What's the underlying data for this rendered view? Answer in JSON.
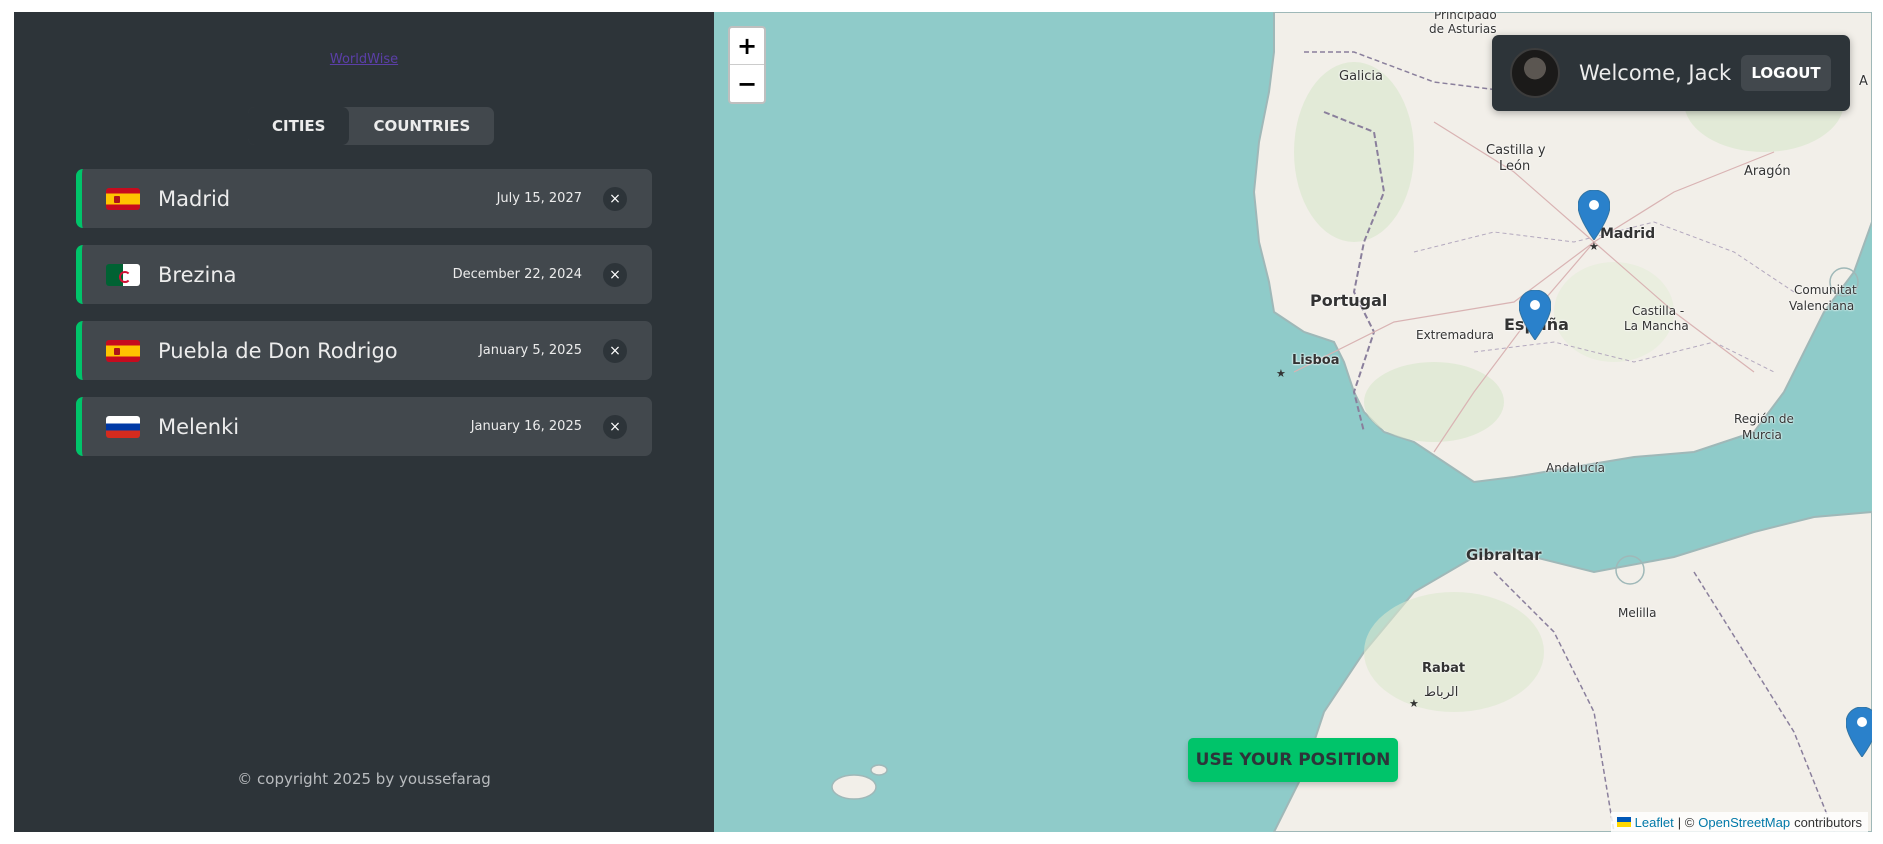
{
  "sidebar": {
    "logo_text": "WorldWise",
    "tabs": [
      {
        "label": "CITIES",
        "active": true
      },
      {
        "label": "COUNTRIES",
        "active": false
      }
    ],
    "cities": [
      {
        "name": "Madrid",
        "date": "July 15, 2027",
        "flag": "es"
      },
      {
        "name": "Brezina",
        "date": "December 22, 2024",
        "flag": "dz"
      },
      {
        "name": "Puebla de Don Rodrigo",
        "date": "January 5, 2025",
        "flag": "es"
      },
      {
        "name": "Melenki",
        "date": "January 16, 2025",
        "flag": "ru"
      }
    ],
    "delete_label": "×",
    "copyright": "© copyright 2025 by youssefarag"
  },
  "map": {
    "zoom_in": "+",
    "zoom_out": "−",
    "user": {
      "welcome": "Welcome, Jack",
      "logout": "LOGOUT"
    },
    "use_position": "USE YOUR POSITION",
    "attribution": {
      "leaflet": "Leaflet",
      "separator": "| ©",
      "osm": "OpenStreetMap",
      "suffix": "contributors"
    },
    "labels": {
      "principado": "Principado",
      "asturias": "de Asturias",
      "galicia": "Galicia",
      "castilla": "Castilla y",
      "leon": "León",
      "aragon": "Aragón",
      "madrid": "Madrid",
      "portugal": "Portugal",
      "espana": "España",
      "comunitat": "Comunitat",
      "valenciana": "Valenciana",
      "castilla_mancha_1": "Castilla -",
      "castilla_mancha_2": "La Mancha",
      "extremadura": "Extremadura",
      "lisboa": "Lisboa",
      "region_1": "Región de",
      "region_2": "Murcia",
      "andalucia": "Andalucía",
      "gibraltar": "Gibraltar",
      "melilla": "Melilla",
      "rabat": "Rabat",
      "rabat_ar": "الرباط",
      "edge": "A"
    },
    "colors": {
      "land": "#f2efe9",
      "water": "#aad3df",
      "accent": "#00c46a",
      "marker": "#2a81cb"
    }
  }
}
